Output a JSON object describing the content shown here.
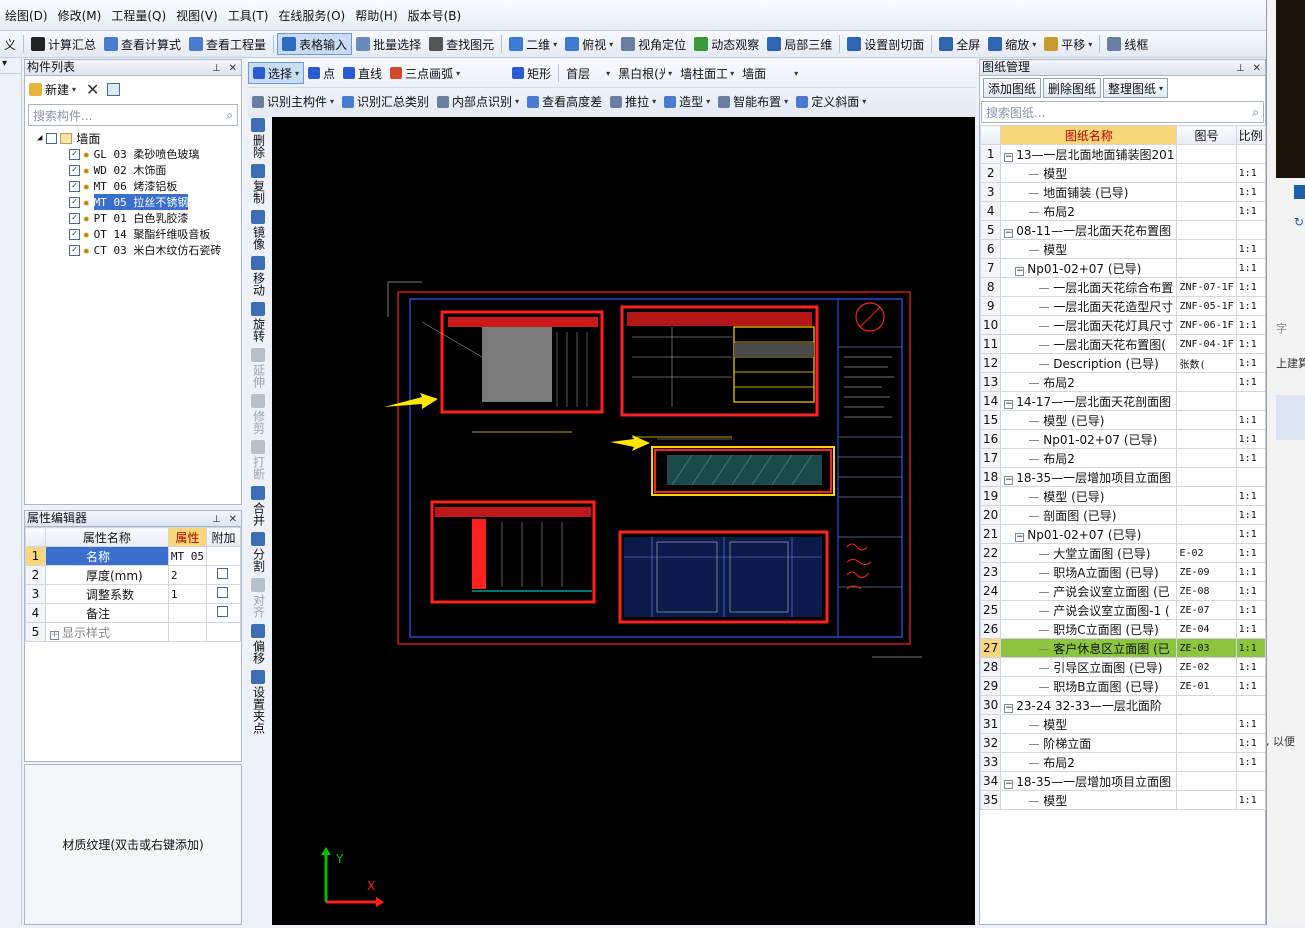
{
  "menu": [
    "绘图(D)",
    "修改(M)",
    "工程量(Q)",
    "视图(V)",
    "工具(T)",
    "在线服务(O)",
    "帮助(H)",
    "版本号(B)"
  ],
  "toolbar1": [
    {
      "label": "义",
      "icon": "define-icon",
      "color": "#3a6ea5"
    },
    {
      "label": "计算汇总",
      "icon": "sigma-icon",
      "color": "#222222"
    },
    {
      "label": "查看计算式",
      "icon": "formula-icon",
      "color": "#4b7bd1"
    },
    {
      "label": "查看工程量",
      "icon": "quantity-icon",
      "color": "#4b7bd1"
    },
    {
      "label": "表格输入",
      "icon": "table-icon",
      "color": "#2a6bc4",
      "active": true
    },
    {
      "label": "批量选择",
      "icon": "batch-select-icon",
      "color": "#6a8bb8"
    },
    {
      "label": "查找图元",
      "icon": "binoculars-icon",
      "color": "#555555"
    },
    {
      "label": "二维",
      "icon": "2d-icon",
      "color": "#3d7ad6",
      "dropdown": true
    },
    {
      "label": "俯视",
      "icon": "top-view-icon",
      "color": "#3d7ad6",
      "dropdown": true
    },
    {
      "label": "视角定位",
      "icon": "view-locate-icon",
      "color": "#6a7fa0"
    },
    {
      "label": "动态观察",
      "icon": "orbit-icon",
      "color": "#3a9a3a"
    },
    {
      "label": "局部三维",
      "icon": "local-3d-icon",
      "color": "#2f64b0"
    },
    {
      "label": "设置剖切面",
      "icon": "section-icon",
      "color": "#2f64b0"
    },
    {
      "label": "全屏",
      "icon": "fullscreen-icon",
      "color": "#2f64b0"
    },
    {
      "label": "缩放",
      "icon": "zoom-icon",
      "color": "#2f64b0",
      "dropdown": true
    },
    {
      "label": "平移",
      "icon": "pan-icon",
      "color": "#c89a2c",
      "dropdown": true
    },
    {
      "label": "线框",
      "icon": "wireframe-icon",
      "color": "#6a7fa0"
    }
  ],
  "component_list": {
    "title": "构件列表",
    "new_label": "新建",
    "search_placeholder": "搜索构件...",
    "root": "墙面",
    "items": [
      {
        "label": "GL 03 柔砂喷色玻璃",
        "selected": false
      },
      {
        "label": "WD 02 木饰面",
        "selected": false
      },
      {
        "label": "MT 06 烤漆铝板",
        "selected": false
      },
      {
        "label": "MT 05 拉丝不锈钢",
        "selected": true
      },
      {
        "label": "PT 01 白色乳胶漆",
        "selected": false
      },
      {
        "label": "OT 14 聚酯纤维吸音板",
        "selected": false
      },
      {
        "label": "CT 03 米白木纹仿石瓷砖",
        "selected": false
      }
    ]
  },
  "property_editor": {
    "title": "属性编辑器",
    "headers": [
      "属性名称",
      "属性",
      "附加"
    ],
    "rows": [
      {
        "n": "1",
        "name": "名称",
        "value": "MT 05",
        "extra": false,
        "selected": true
      },
      {
        "n": "2",
        "name": "厚度(mm)",
        "value": "2",
        "extra": true
      },
      {
        "n": "3",
        "name": "调整系数",
        "value": "1",
        "extra": true
      },
      {
        "n": "4",
        "name": "备注",
        "value": "",
        "extra": true
      },
      {
        "n": "5",
        "name": "显示样式",
        "value": "",
        "extra": false,
        "expand": true
      }
    ]
  },
  "texture_hint": "材质纹理(双击或右键添加)",
  "edit_tools": [
    {
      "label": "删除",
      "icon": "delete-icon",
      "enabled": true
    },
    {
      "label": "复制",
      "icon": "copy-icon",
      "enabled": true
    },
    {
      "label": "镜像",
      "icon": "mirror-icon",
      "enabled": true
    },
    {
      "label": "移动",
      "icon": "move-icon",
      "enabled": true
    },
    {
      "label": "旋转",
      "icon": "rotate-icon",
      "enabled": true
    },
    {
      "label": "延伸",
      "icon": "extend-icon",
      "enabled": false
    },
    {
      "label": "修剪",
      "icon": "trim-icon",
      "enabled": false
    },
    {
      "label": "打断",
      "icon": "break-icon",
      "enabled": false
    },
    {
      "label": "合并",
      "icon": "merge-icon",
      "enabled": true
    },
    {
      "label": "分割",
      "icon": "split-icon",
      "enabled": true
    },
    {
      "label": "对齐",
      "icon": "align-icon",
      "enabled": false
    },
    {
      "label": "偏移",
      "icon": "offset-icon",
      "enabled": true
    },
    {
      "label": "设置夹点",
      "icon": "grip-icon",
      "enabled": true
    }
  ],
  "draw_toolbar": {
    "row1": [
      {
        "label": "选择",
        "icon": "cursor-icon",
        "active": true,
        "dropdown": true
      },
      {
        "label": "点",
        "icon": "point-icon"
      },
      {
        "label": "直线",
        "icon": "line-icon"
      },
      {
        "label": "三点画弧",
        "icon": "arc-icon",
        "dropdown": true
      },
      {
        "label": "矩形",
        "icon": "rect-icon"
      }
    ],
    "floor": "首层",
    "layer": "黑白根(光",
    "wall_type": "墙柱面工",
    "category": "墙面",
    "row2": [
      {
        "label": "识别主构件",
        "icon": "recognize-icon",
        "dropdown": true
      },
      {
        "label": "识别汇总类别",
        "icon": "recognize-sum-icon"
      },
      {
        "label": "内部点识别",
        "icon": "inner-point-icon",
        "dropdown": true
      },
      {
        "label": "查看高度差",
        "icon": "height-diff-icon"
      },
      {
        "label": "推拉",
        "icon": "push-pull-icon",
        "dropdown": true
      },
      {
        "label": "造型",
        "icon": "shape-icon",
        "dropdown": true
      },
      {
        "label": "智能布置",
        "icon": "smart-layout-icon",
        "dropdown": true
      },
      {
        "label": "定义斜面",
        "icon": "slope-icon",
        "dropdown": true
      }
    ]
  },
  "axis": {
    "x": "X",
    "y": "Y"
  },
  "sheet_manager": {
    "title": "图纸管理",
    "buttons": [
      "添加图纸",
      "删除图纸",
      "整理图纸"
    ],
    "search_placeholder": "搜索图纸...",
    "headers": [
      "图纸名称",
      "图号",
      "比例"
    ],
    "rows": [
      {
        "n": "1",
        "name": "13—一层北面地面铺装图201",
        "code": "",
        "scale": "",
        "level": 0,
        "group": true
      },
      {
        "n": "2",
        "name": "模型",
        "code": "",
        "scale": "1:1",
        "level": 1
      },
      {
        "n": "3",
        "name": "地面铺装 (已导)",
        "code": "",
        "scale": "1:1",
        "level": 1
      },
      {
        "n": "4",
        "name": "布局2",
        "code": "",
        "scale": "1:1",
        "level": 1
      },
      {
        "n": "5",
        "name": "08-11—一层北面天花布置图",
        "code": "",
        "scale": "",
        "level": 0,
        "group": true
      },
      {
        "n": "6",
        "name": "模型",
        "code": "",
        "scale": "1:1",
        "level": 1
      },
      {
        "n": "7",
        "name": "Np01-02+07 (已导)",
        "code": "",
        "scale": "1:1",
        "level": 1,
        "group": true
      },
      {
        "n": "8",
        "name": "一层北面天花综合布置",
        "code": "ZNF-07-1F",
        "scale": "1:1",
        "level": 2
      },
      {
        "n": "9",
        "name": "一层北面天花造型尺寸",
        "code": "ZNF-05-1F",
        "scale": "1:1",
        "level": 2
      },
      {
        "n": "10",
        "name": "一层北面天花灯具尺寸",
        "code": "ZNF-06-1F",
        "scale": "1:1",
        "level": 2
      },
      {
        "n": "11",
        "name": "一层北面天花布置图(",
        "code": "ZNF-04-1F",
        "scale": "1:1",
        "level": 2
      },
      {
        "n": "12",
        "name": "Description (已导)",
        "code": "张数(",
        "scale": "1:1",
        "level": 2
      },
      {
        "n": "13",
        "name": "布局2",
        "code": "",
        "scale": "1:1",
        "level": 1
      },
      {
        "n": "14",
        "name": "14-17—一层北面天花剖面图",
        "code": "",
        "scale": "",
        "level": 0,
        "group": true
      },
      {
        "n": "15",
        "name": "模型 (已导)",
        "code": "",
        "scale": "1:1",
        "level": 1
      },
      {
        "n": "16",
        "name": "Np01-02+07 (已导)",
        "code": "",
        "scale": "1:1",
        "level": 1
      },
      {
        "n": "17",
        "name": "布局2",
        "code": "",
        "scale": "1:1",
        "level": 1
      },
      {
        "n": "18",
        "name": "18-35—一层增加项目立面图",
        "code": "",
        "scale": "",
        "level": 0,
        "group": true
      },
      {
        "n": "19",
        "name": "模型 (已导)",
        "code": "",
        "scale": "1:1",
        "level": 1
      },
      {
        "n": "20",
        "name": "剖面图 (已导)",
        "code": "",
        "scale": "1:1",
        "level": 1
      },
      {
        "n": "21",
        "name": "Np01-02+07 (已导)",
        "code": "",
        "scale": "1:1",
        "level": 1,
        "group": true
      },
      {
        "n": "22",
        "name": "大堂立面图 (已导)",
        "code": "E-02",
        "scale": "1:1",
        "level": 2
      },
      {
        "n": "23",
        "name": "职场A立面图 (已导)",
        "code": "ZE-09",
        "scale": "1:1",
        "level": 2
      },
      {
        "n": "24",
        "name": "产说会议室立面图 (已",
        "code": "ZE-08",
        "scale": "1:1",
        "level": 2
      },
      {
        "n": "25",
        "name": "产说会议室立面图-1 (",
        "code": "ZE-07",
        "scale": "1:1",
        "level": 2
      },
      {
        "n": "26",
        "name": "职场C立面图 (已导)",
        "code": "ZE-04",
        "scale": "1:1",
        "level": 2
      },
      {
        "n": "27",
        "name": "客户休息区立面图 (已",
        "code": "ZE-03",
        "scale": "1:1",
        "level": 2,
        "selected": true
      },
      {
        "n": "28",
        "name": "引导区立面图 (已导)",
        "code": "ZE-02",
        "scale": "1:1",
        "level": 2
      },
      {
        "n": "29",
        "name": "职场B立面图 (已导)",
        "code": "ZE-01",
        "scale": "1:1",
        "level": 2
      },
      {
        "n": "30",
        "name": "23-24  32-33—一层北面阶",
        "code": "",
        "scale": "",
        "level": 0,
        "group": true
      },
      {
        "n": "31",
        "name": "模型",
        "code": "",
        "scale": "1:1",
        "level": 1
      },
      {
        "n": "32",
        "name": "阶梯立面",
        "code": "",
        "scale": "1:1",
        "level": 1
      },
      {
        "n": "33",
        "name": "布局2",
        "code": "",
        "scale": "1:1",
        "level": 1
      },
      {
        "n": "34",
        "name": "18-35—一层增加项目立面图",
        "code": "",
        "scale": "",
        "level": 0,
        "group": true
      },
      {
        "n": "35",
        "name": "模型",
        "code": "",
        "scale": "1:1",
        "level": 1
      }
    ]
  },
  "right_edge_fragments": [
    "字",
    "上建算",
    ", 以便"
  ],
  "colors": {
    "accent": "#2a6bc4",
    "selected_row": "#8cc63f",
    "cad_red": "#ff2020",
    "cad_yellow": "#ffd400",
    "cad_blue": "#2a5bff"
  }
}
